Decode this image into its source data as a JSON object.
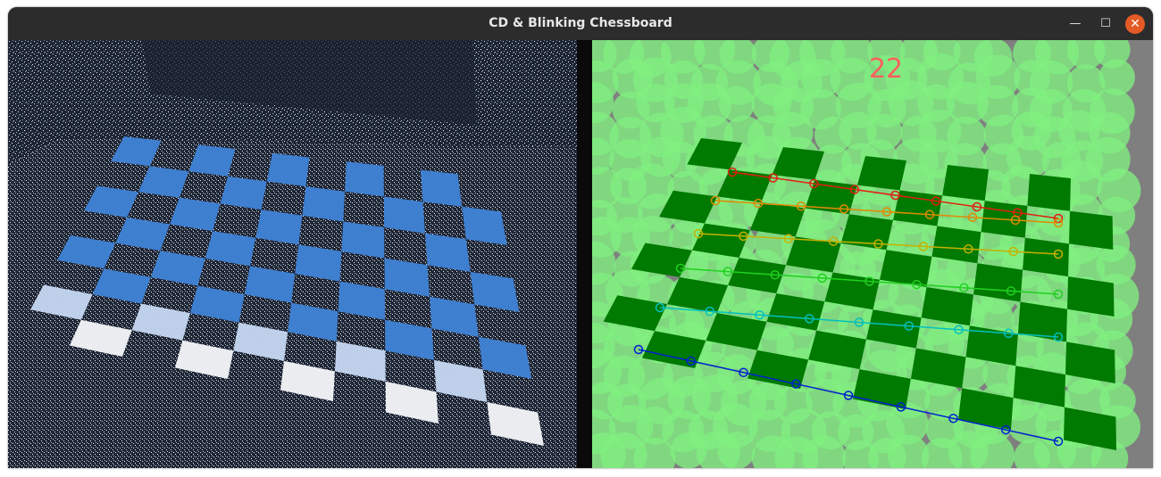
{
  "window": {
    "title": "CD & Blinking Chessboard",
    "buttons": {
      "minimize": "—",
      "maximize": "☐",
      "close": "✕"
    }
  },
  "left_view": {
    "description_icon": "event-camera-frame"
  },
  "right_view": {
    "frame_counter": "22"
  },
  "colors": {
    "titlebar": "#2c2c2c",
    "close_button": "#e35a25",
    "event_blue": "#3f7fd0",
    "event_bg": "#1d2535",
    "square_green": "#007a00",
    "light_green": "#80f080",
    "counter_red": "#ff6060",
    "corner_rows": [
      "#e02010",
      "#e08a00",
      "#c8b000",
      "#20d020",
      "#00c0c0",
      "#0020d0"
    ]
  }
}
